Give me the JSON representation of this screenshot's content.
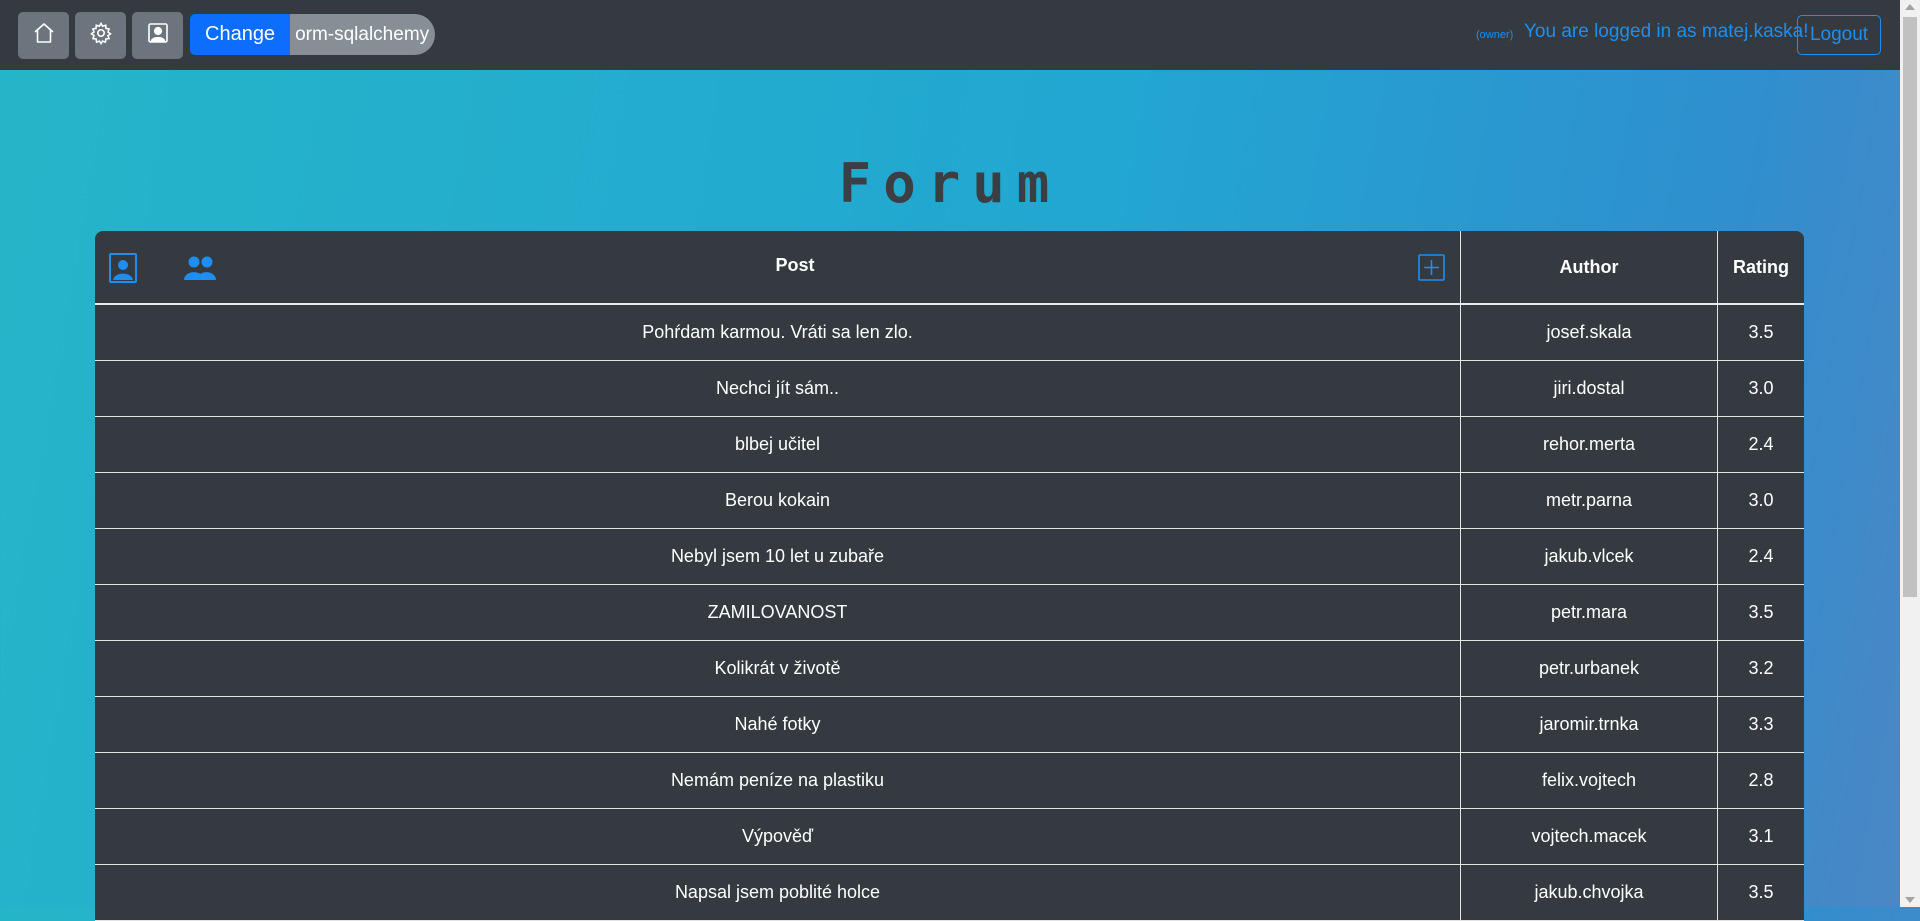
{
  "navbar": {
    "home_icon": "home-icon",
    "settings_icon": "gear-icon",
    "profile_icon": "user-icon",
    "change_label": "Change",
    "db_name": "orm-sqlalchemy",
    "role": "(owner)",
    "logged_in_text": "You are logged in as matej.kaska!",
    "logout_label": "Logout",
    "accent_color": "#1e8ef0"
  },
  "page": {
    "title": "Forum"
  },
  "table": {
    "headers": {
      "post": "Post",
      "author": "Author",
      "rating": "Rating"
    },
    "icons": {
      "my_posts": "user-square-icon",
      "all_posts": "users-icon",
      "add_post": "plus-square-icon"
    },
    "rows": [
      {
        "post": "Pohŕdam karmou. Vráti sa len zlo.",
        "author": "josef.skala",
        "rating": "3.5"
      },
      {
        "post": "Nechci jít sám..",
        "author": "jiri.dostal",
        "rating": "3.0"
      },
      {
        "post": "blbej učitel",
        "author": "rehor.merta",
        "rating": "2.4"
      },
      {
        "post": "Berou kokain",
        "author": "metr.parna",
        "rating": "3.0"
      },
      {
        "post": "Nebyl jsem 10 let u zubaře",
        "author": "jakub.vlcek",
        "rating": "2.4"
      },
      {
        "post": "ZAMILOVANOST",
        "author": "petr.mara",
        "rating": "3.5"
      },
      {
        "post": "Kolikrát v životě",
        "author": "petr.urbanek",
        "rating": "3.2"
      },
      {
        "post": "Nahé fotky",
        "author": "jaromir.trnka",
        "rating": "3.3"
      },
      {
        "post": "Nemám peníze na plastiku",
        "author": "felix.vojtech",
        "rating": "2.8"
      },
      {
        "post": "Výpověď",
        "author": "vojtech.macek",
        "rating": "3.1"
      },
      {
        "post": "Napsal jsem poblité holce",
        "author": "jakub.chvojka",
        "rating": "3.5"
      }
    ]
  }
}
